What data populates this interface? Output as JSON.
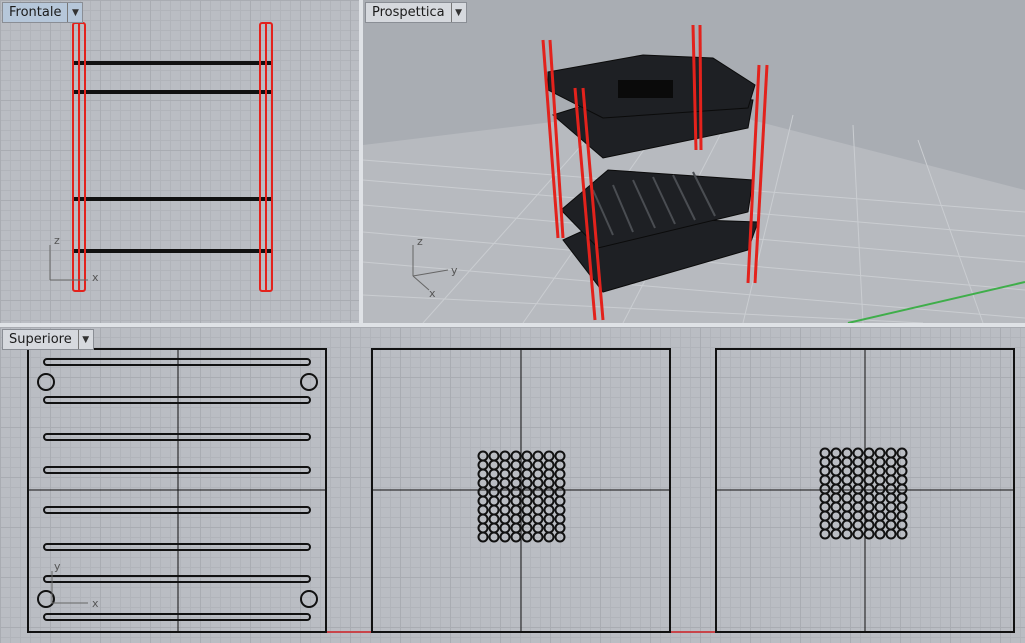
{
  "viewports": {
    "front": {
      "label": "Frontale",
      "axis_v": "z",
      "axis_h": "x"
    },
    "perspective": {
      "label": "Prospettica",
      "axis_v": "z",
      "axis_h": "y",
      "axis_d": "x"
    },
    "top": {
      "label": "Superiore",
      "axis_v": "y",
      "axis_h": "x"
    }
  },
  "icons": {
    "dropdown": "chevron-down-icon"
  },
  "colors": {
    "selection": "#e3221c",
    "geometry": "#111111",
    "active_tab": "#b6c7da",
    "grid_axis_x": "#c8454a",
    "grid_axis_y": "#3fae4a"
  }
}
